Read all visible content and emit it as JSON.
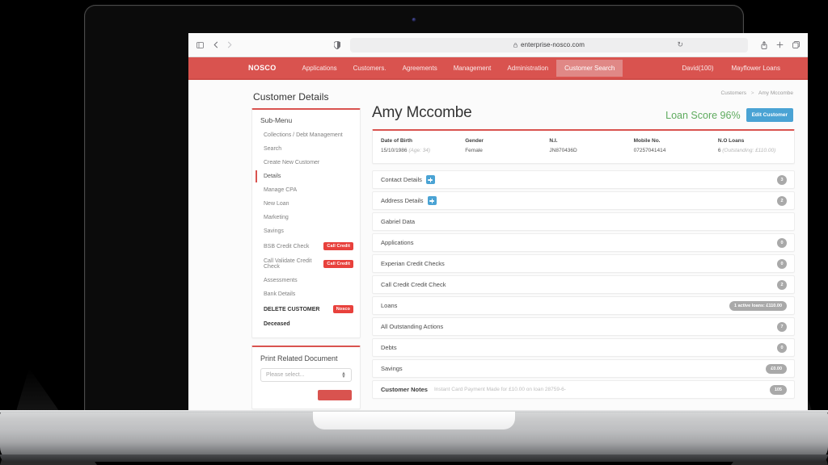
{
  "device": {
    "label": "MacBook Pro"
  },
  "browser": {
    "sidebar_toggle_icon": "sidebar-icon",
    "back_icon": "chevron-left-icon",
    "forward_icon": "chevron-right-icon",
    "shield_icon": "privacy-shield-icon",
    "lock_icon": "lock-icon",
    "url": "enterprise-nosco.com",
    "reload_icon": "reload-icon",
    "share_icon": "share-icon",
    "new_tab_icon": "plus-icon",
    "tabs_icon": "tabs-icon"
  },
  "appnav": {
    "brand": "NOSCO",
    "links": [
      {
        "label": "Applications",
        "active": false
      },
      {
        "label": "Customers.",
        "active": false
      },
      {
        "label": "Agreements",
        "active": false
      },
      {
        "label": "Management",
        "active": false
      },
      {
        "label": "Administration",
        "active": false
      },
      {
        "label": "Customer Search",
        "active": true
      }
    ],
    "right": [
      {
        "label": "David(100)"
      },
      {
        "label": "Mayflower Loans"
      }
    ],
    "accent": "#d9534f"
  },
  "sidebar": {
    "title": "Customer Details",
    "submenu_heading": "Sub-Menu",
    "items": [
      {
        "label": "Collections / Debt Management",
        "current": false,
        "strong": false,
        "pill": null
      },
      {
        "label": "Search",
        "current": false,
        "strong": false,
        "pill": null
      },
      {
        "label": "Create New Customer",
        "current": false,
        "strong": false,
        "pill": null
      },
      {
        "label": "Details",
        "current": true,
        "strong": false,
        "pill": null
      },
      {
        "label": "Manage CPA",
        "current": false,
        "strong": false,
        "pill": null
      },
      {
        "label": "New Loan",
        "current": false,
        "strong": false,
        "pill": null
      },
      {
        "label": "Marketing",
        "current": false,
        "strong": false,
        "pill": null
      },
      {
        "label": "Savings",
        "current": false,
        "strong": false,
        "pill": null
      },
      {
        "label": "BSB Credit Check",
        "current": false,
        "strong": false,
        "pill": "Call Credit"
      },
      {
        "label": "Call Validate Credit Check",
        "current": false,
        "strong": false,
        "pill": "Call Credit"
      },
      {
        "label": "Assessments",
        "current": false,
        "strong": false,
        "pill": null
      },
      {
        "label": "Bank Details",
        "current": false,
        "strong": false,
        "pill": null
      },
      {
        "label": "DELETE CUSTOMER",
        "current": false,
        "strong": true,
        "pill": "Nosco"
      },
      {
        "label": "Deceased",
        "current": false,
        "strong": true,
        "pill": null
      }
    ],
    "print": {
      "title": "Print Related Document",
      "select_value": "Please select...",
      "select_icon": "stepper-icon",
      "button_label": ""
    }
  },
  "main": {
    "breadcrumb": {
      "parent": "Customers",
      "separator": ">",
      "current": "Amy Mccombe"
    },
    "customer_name": "Amy Mccombe",
    "loan_score_label": "Loan Score 96%",
    "edit_button": "Edit Customer",
    "stats": [
      {
        "key": "Date of Birth",
        "value": "15/10/1986 ",
        "note": "(Age: 34)"
      },
      {
        "key": "Gender",
        "value": "Female",
        "note": ""
      },
      {
        "key": "N.I.",
        "value": "JN870436D",
        "note": ""
      },
      {
        "key": "Mobile No.",
        "value": "07257041414",
        "note": ""
      },
      {
        "key": "N.O Loans",
        "value": "6 ",
        "note": "(Outstanding: £110.00)"
      }
    ],
    "accordions": [
      {
        "label": "Contact Details",
        "bold": false,
        "plus": true,
        "note": "",
        "badge": "3",
        "wide": false
      },
      {
        "label": "Address Details",
        "bold": false,
        "plus": true,
        "note": "",
        "badge": "2",
        "wide": false
      },
      {
        "label": "Gabriel Data",
        "bold": false,
        "plus": false,
        "note": "",
        "badge": "",
        "wide": false
      },
      {
        "label": "Applications",
        "bold": false,
        "plus": false,
        "note": "",
        "badge": "0",
        "wide": false
      },
      {
        "label": "Experian Credit Checks",
        "bold": false,
        "plus": false,
        "note": "",
        "badge": "0",
        "wide": false
      },
      {
        "label": "Call Credit Credit Check",
        "bold": false,
        "plus": false,
        "note": "",
        "badge": "2",
        "wide": false
      },
      {
        "label": "Loans",
        "bold": false,
        "plus": false,
        "note": "",
        "badge": "1 active loans: £110.00",
        "wide": true
      },
      {
        "label": "All Outstanding Actions",
        "bold": false,
        "plus": false,
        "note": "",
        "badge": "7",
        "wide": false
      },
      {
        "label": "Debts",
        "bold": false,
        "plus": false,
        "note": "",
        "badge": "0",
        "wide": false
      },
      {
        "label": "Savings",
        "bold": false,
        "plus": false,
        "note": "",
        "badge": "£0.00",
        "wide": true
      },
      {
        "label": "Customer Notes",
        "bold": true,
        "plus": false,
        "note": "Instant Card Payment Made for £10.00 on loan 28759-6-",
        "badge": "105",
        "wide": true
      }
    ]
  }
}
